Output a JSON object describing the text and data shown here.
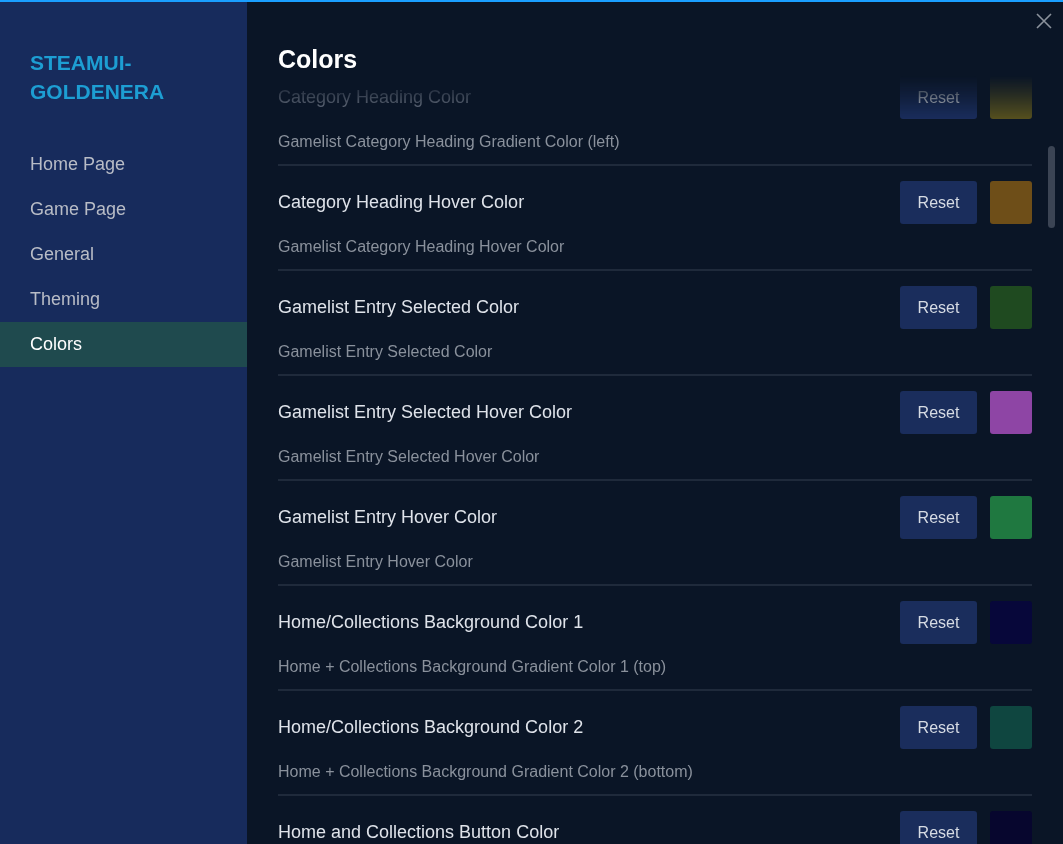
{
  "sidebar": {
    "title": "STEAMUI-GOLDENERA",
    "items": [
      {
        "label": "Home Page",
        "selected": false
      },
      {
        "label": "Game Page",
        "selected": false
      },
      {
        "label": "General",
        "selected": false
      },
      {
        "label": "Theming",
        "selected": false
      },
      {
        "label": "Colors",
        "selected": true
      }
    ]
  },
  "page": {
    "title": "Colors"
  },
  "rows": [
    {
      "label": "Category Heading Color",
      "description": "Gamelist Category Heading Gradient Color (left)",
      "button": "Reset",
      "color": "#56501e",
      "faded": true
    },
    {
      "label": "Category Heading Hover Color",
      "description": "Gamelist Category Heading Hover Color",
      "button": "Reset",
      "color": "#6e4e18",
      "faded": false
    },
    {
      "label": "Gamelist Entry Selected Color",
      "description": "Gamelist Entry Selected Color",
      "button": "Reset",
      "color": "#1f4a20",
      "faded": false
    },
    {
      "label": "Gamelist Entry Selected Hover Color",
      "description": "Gamelist Entry Selected Hover Color",
      "button": "Reset",
      "color": "#8e45a5",
      "faded": false
    },
    {
      "label": "Gamelist Entry Hover Color",
      "description": "Gamelist Entry Hover Color",
      "button": "Reset",
      "color": "#1f7840",
      "faded": false
    },
    {
      "label": "Home/Collections Background Color 1",
      "description": "Home + Collections Background Gradient Color 1 (top)",
      "button": "Reset",
      "color": "#07073a",
      "faded": false
    },
    {
      "label": "Home/Collections Background Color 2",
      "description": "Home + Collections Background Gradient Color 2 (bottom)",
      "button": "Reset",
      "color": "#0f4640",
      "faded": false
    },
    {
      "label": "Home and Collections Button Color",
      "description": "",
      "button": "Reset",
      "color": "#07062e",
      "faded": false
    }
  ]
}
